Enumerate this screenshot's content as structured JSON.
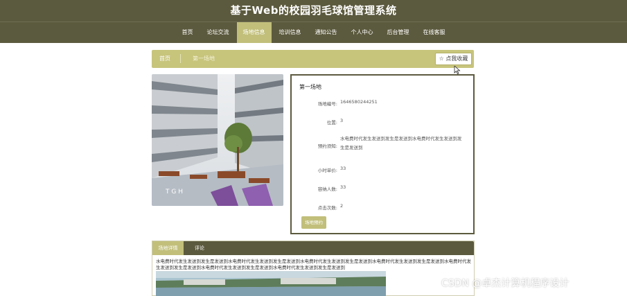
{
  "site": {
    "title": "基于Web的校园羽毛球馆管理系统"
  },
  "nav": [
    {
      "label": "首页",
      "active": false
    },
    {
      "label": "论坛交流",
      "active": false
    },
    {
      "label": "场地信息",
      "active": true
    },
    {
      "label": "培训信息",
      "active": false
    },
    {
      "label": "通知公告",
      "active": false
    },
    {
      "label": "个人中心",
      "active": false
    },
    {
      "label": "后台管理",
      "active": false
    },
    {
      "label": "在线客服",
      "active": false
    }
  ],
  "breadcrumb": {
    "home": "首页",
    "current": "第一场地"
  },
  "favorite": {
    "label": "☆ 点我收藏"
  },
  "detail": {
    "title": "第一场地",
    "fields": [
      {
        "label": "场地编号:",
        "value": "1646580244251"
      },
      {
        "label": "位置:",
        "value": "3"
      },
      {
        "label": "预约须知:",
        "value": "水电费时代发生发送到发生是发送到水电费时代发生发送到发生是发送到"
      },
      {
        "label": "小时单价:",
        "value": "33"
      },
      {
        "label": "容纳人数:",
        "value": "33"
      },
      {
        "label": "点击次数:",
        "value": "2"
      }
    ],
    "book_label": "场地预约"
  },
  "tabs": [
    {
      "label": "场地详情",
      "active": true
    },
    {
      "label": "评论",
      "active": false
    }
  ],
  "description": "水电费时代发生发送到发生是发送到水电费时代发生发送到发生是发送到水电费时代发生发送到发生是发送到水电费时代发生发送到发生是发送到水电费时代发生发送到发生是发送到水电费时代发生发送到发生是发送到水电费时代发生发送到发生是发送到",
  "watermark": "CSDN @卓杰计算机程序设计",
  "colors": {
    "header": "#5c5a3e",
    "accent": "#c1bf7a",
    "breadcrumb": "#c7c47c"
  }
}
